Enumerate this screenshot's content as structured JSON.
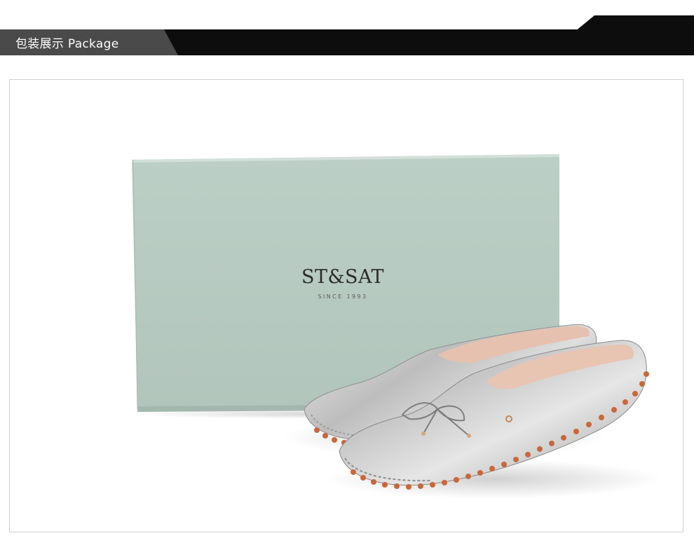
{
  "header": {
    "title": "包装展示  Package"
  },
  "box": {
    "brand": "ST&SAT",
    "tagline": "SINCE 1993"
  },
  "colors": {
    "banner_dark": "#0d0d0d",
    "banner_tab": "#4a4a4a",
    "box_green": "#b9cbc3",
    "shoe_silver": "#c9c9c9",
    "lining_pink": "#e7c3b2",
    "sole_orange": "#c9673a"
  }
}
